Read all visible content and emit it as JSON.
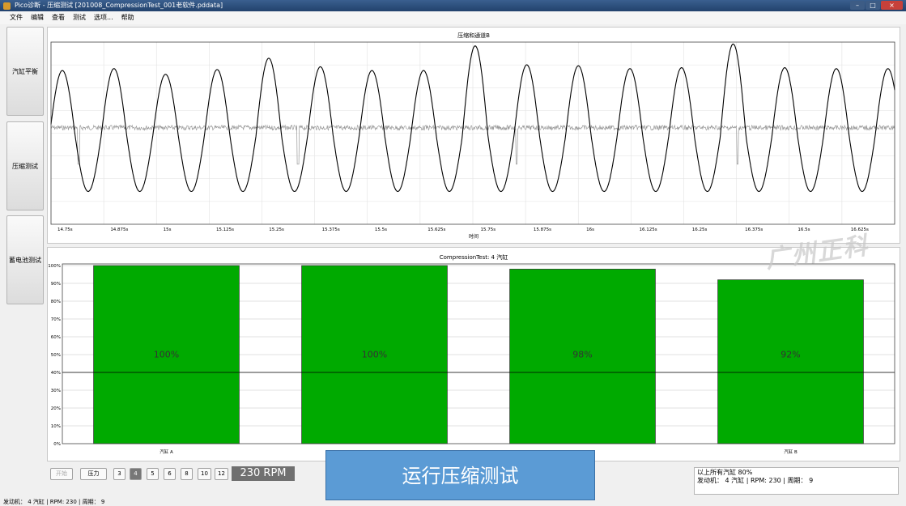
{
  "window": {
    "title": "Pico诊断 - 压缩测试 [201008_CompressionTest_001老软件.pddata]",
    "controls": [
      "–",
      "□",
      "×"
    ]
  },
  "menu": [
    "文件",
    "编辑",
    "查看",
    "测试",
    "选项...",
    "帮助"
  ],
  "sidebar": [
    {
      "label": "汽缸平衡"
    },
    {
      "label": "压缩测试"
    },
    {
      "label": "蓄电池测试"
    }
  ],
  "waveform": {
    "title": "压缩和通道B",
    "xlabel": "时间",
    "x_ticks": [
      "14.75s",
      "14.875s",
      "15s",
      "15.125s",
      "15.25s",
      "15.375s",
      "15.5s",
      "15.625s",
      "15.75s",
      "15.875s",
      "16s",
      "16.125s",
      "16.25s",
      "16.375s",
      "16.5s",
      "16.625s"
    ],
    "series": [
      {
        "color": "#000000"
      },
      {
        "color": "#999999"
      }
    ]
  },
  "chart_data": {
    "type": "bar",
    "title": "CompressionTest: 4 汽缸",
    "categories": [
      "汽缸 A",
      "",
      "",
      "汽缸 B"
    ],
    "values": [
      100,
      100,
      98,
      92
    ],
    "value_labels": [
      "100%",
      "100%",
      "98%",
      "92%"
    ],
    "y_ticks": [
      "0%",
      "10%",
      "20%",
      "30%",
      "40%",
      "50%",
      "60%",
      "70%",
      "80%",
      "90%",
      "100%"
    ],
    "ylim": [
      0,
      100
    ],
    "reference_line": 40,
    "bar_color": "#00aa00",
    "grid": true
  },
  "toolbar": {
    "start_label": "开始",
    "pressure_label": "压力",
    "cylinder_options": [
      "3",
      "4",
      "5",
      "6",
      "8",
      "10",
      "12"
    ],
    "selected_cylinder": "4",
    "rpm": "230 RPM"
  },
  "overlay": {
    "text": "运行压缩测试"
  },
  "info": {
    "line1": "以上所有汽缸 80%",
    "line2": "发动机： 4 汽缸 | RPM: 230 | 周期： 9"
  },
  "status": "发动机： 4 汽缸 | RPM: 230 | 周期： 9",
  "watermark": "广州正科"
}
